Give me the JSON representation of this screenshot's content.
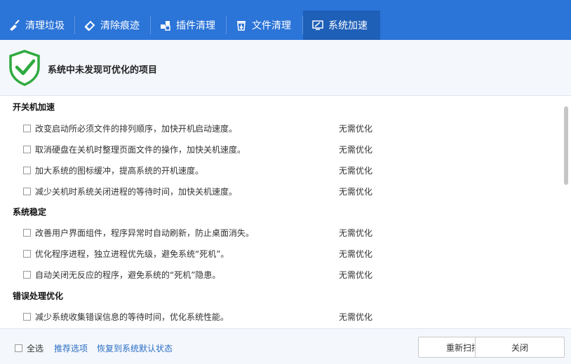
{
  "tabs": [
    {
      "label": "清理垃圾",
      "icon": "broom-icon"
    },
    {
      "label": "清除痕迹",
      "icon": "eraser-icon"
    },
    {
      "label": "插件清理",
      "icon": "plugin-icon"
    },
    {
      "label": "文件清理",
      "icon": "trash-icon"
    },
    {
      "label": "系统加速",
      "icon": "monitor-icon"
    }
  ],
  "active_tab": "系统加速",
  "banner": {
    "title": "系统中未发现可优化的项目"
  },
  "sections": [
    {
      "title": "开关机加速",
      "items": [
        {
          "text": "改变启动所必须文件的排列顺序，加快开机启动速度。",
          "status": "无需优化"
        },
        {
          "text": "取消硬盘在关机时整理页面文件的操作，加快关机速度。",
          "status": "无需优化"
        },
        {
          "text": "加大系统的图标缓冲，提高系统的开机速度。",
          "status": "无需优化"
        },
        {
          "text": "减少关机时系统关闭进程的等待时间，加快关机速度。",
          "status": "无需优化"
        }
      ]
    },
    {
      "title": "系统稳定",
      "items": [
        {
          "text": "改善用户界面组件，程序异常时自动刷新，防止桌面消失。",
          "status": "无需优化"
        },
        {
          "text": "优化程序进程，独立进程优先级，避免系统“死机”。",
          "status": "无需优化"
        },
        {
          "text": "自动关闭无反应的程序，避免系统的“死机”隐患。",
          "status": "无需优化"
        }
      ]
    },
    {
      "title": "错误处理优化",
      "items": [
        {
          "text": "减少系统收集错误信息的等待时间，优化系统性能。",
          "status": "无需优化"
        }
      ]
    }
  ],
  "footer": {
    "select_all": "全选",
    "recommend": "推荐选项",
    "restore": "恢复到系统默认状态",
    "rescan": "重新扫描",
    "close": "关闭"
  },
  "colors": {
    "tab_bar": "#2b74d8",
    "tab_active": "#1e5fb8",
    "shield_green": "#2faa3f",
    "link": "#2b6fc7"
  }
}
